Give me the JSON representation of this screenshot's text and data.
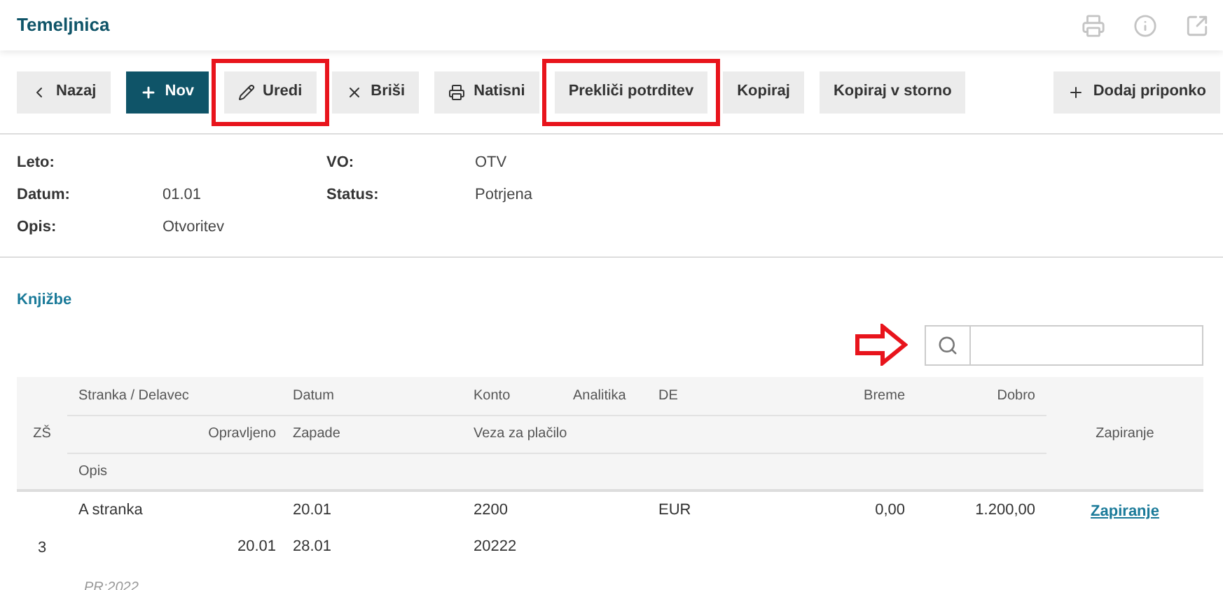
{
  "window": {
    "title": "Temeljnica"
  },
  "toolbar": [
    {
      "kind": "back",
      "label": "Nazaj",
      "highlighted": false
    },
    {
      "kind": "primary",
      "label": "Nov",
      "highlighted": false
    },
    {
      "kind": "edit",
      "label": "Uredi",
      "highlighted": true
    },
    {
      "kind": "delete",
      "label": "Briši",
      "highlighted": false
    },
    {
      "kind": "print",
      "label": "Natisni",
      "highlighted": false
    },
    {
      "kind": "plain",
      "label": "Prekliči potrditev",
      "highlighted": true
    },
    {
      "kind": "plain",
      "label": "Kopiraj",
      "highlighted": false
    },
    {
      "kind": "plain",
      "label": "Kopiraj v storno",
      "highlighted": false
    },
    {
      "kind": "attach",
      "label": "Dodaj priponko",
      "highlighted": false
    }
  ],
  "details": [
    {
      "label": "Leto:",
      "label2": "VO:",
      "value2": "OTV"
    },
    {
      "label": "Datum:",
      "value": "01.01",
      "label2": "Status:",
      "value2": "Potrjena"
    },
    {
      "label": "Opis:",
      "value": "Otvoritev"
    }
  ],
  "section": {
    "title": "Knjižbe",
    "search_arrow": true
  },
  "table": {
    "headers": {
      "zs": "ZŠ",
      "stranka": "Stranka / Delavec",
      "datum": "Datum",
      "konto": "Konto",
      "analitika": "Analitika",
      "de": "DE",
      "breme": "Breme",
      "dobro": "Dobro",
      "opravljeno": "Opravljeno",
      "zapade": "Zapade",
      "veza": "Veza za plačilo",
      "opis": "Opis",
      "zapiranje": "Zapiranje"
    },
    "rows": [
      {
        "zs": "3",
        "stranka": "A stranka",
        "datum": "20.01",
        "konto": "2200",
        "de": "EUR",
        "breme": "0,00",
        "dobro": "1.200,00",
        "opravljeno": "20.01",
        "zapade": "28.01",
        "veza": "20222",
        "opis": "PR:2022",
        "zapiranje": "Zapiranje"
      }
    ]
  }
}
